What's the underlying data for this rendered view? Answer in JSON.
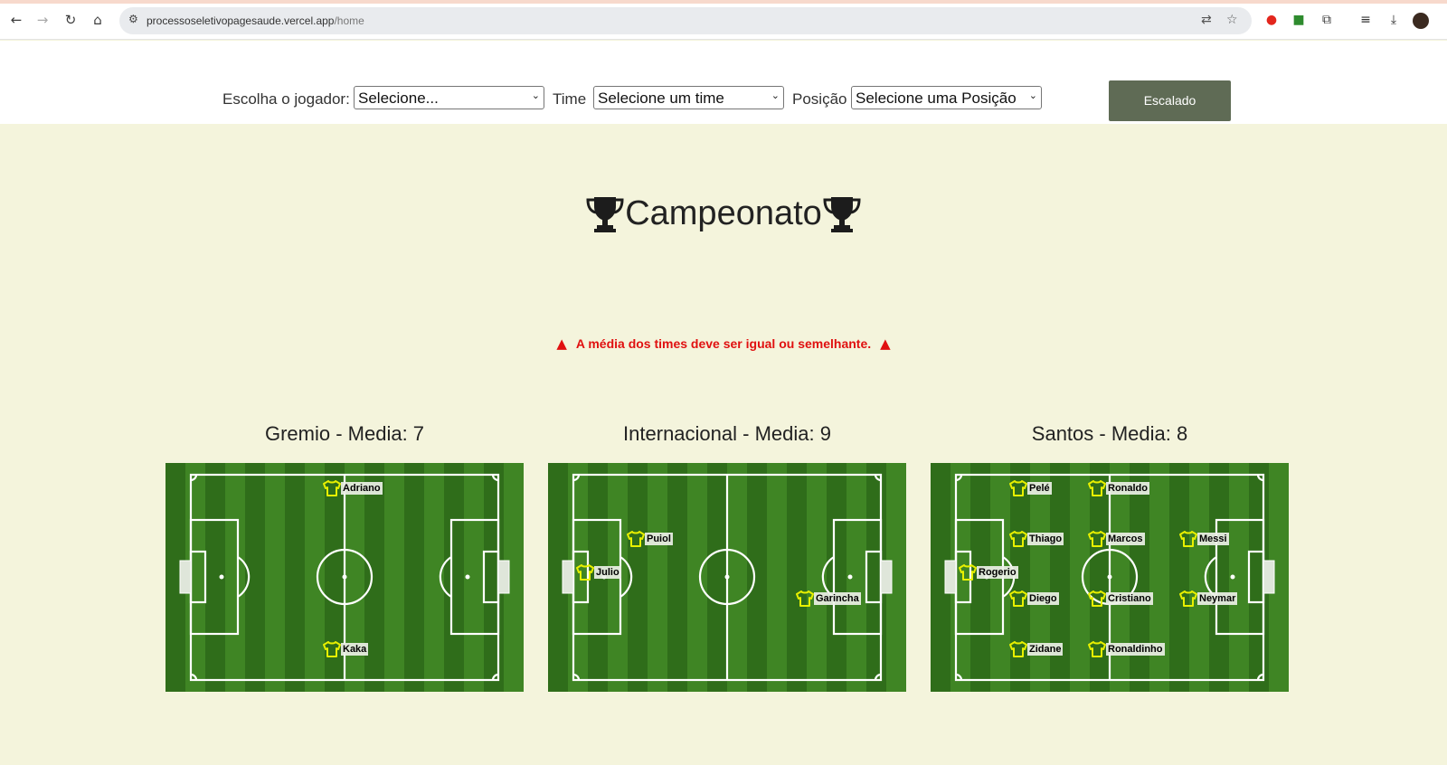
{
  "browser": {
    "url_host": "processoseletivopagesaude.vercel.app",
    "url_path": "/home"
  },
  "form": {
    "player_label": "Escolha o jogador:",
    "player_value": "Selecione...",
    "team_label": "Time",
    "team_value": "Selecione um time",
    "position_label": "Posição",
    "position_value": "Selecione uma Posição",
    "submit_label": "Escalado"
  },
  "page": {
    "title": "Campeonato",
    "warning": "A média dos times deve ser igual ou semelhante."
  },
  "teams": [
    {
      "title": "Gremio - Media: 7",
      "players": [
        "Adriano",
        "Kaka"
      ]
    },
    {
      "title": "Internacional - Media: 9",
      "players": [
        "Puiol",
        "Julio",
        "Garincha"
      ]
    },
    {
      "title": "Santos - Media: 8",
      "players": [
        "Pelé",
        "Ronaldo",
        "Thiago",
        "Marcos",
        "Messi",
        "Rogerio",
        "Diego",
        "Cristiano",
        "Neymar",
        "Zidane",
        "Ronaldinho"
      ]
    }
  ],
  "colors": {
    "background": "#f4f4dc",
    "button": "#5f6b55",
    "warning": "#e01010",
    "pitch_dark": "#2f6d1a",
    "pitch_light": "#3f8524",
    "shirt": "#e8f000"
  },
  "icons": {
    "back": "arrow-left-icon",
    "forward": "arrow-right-icon",
    "reload": "reload-icon",
    "home": "home-icon",
    "trophy": "trophy-icon",
    "warning": "warning-triangle-icon",
    "shirt": "shirt-icon"
  }
}
